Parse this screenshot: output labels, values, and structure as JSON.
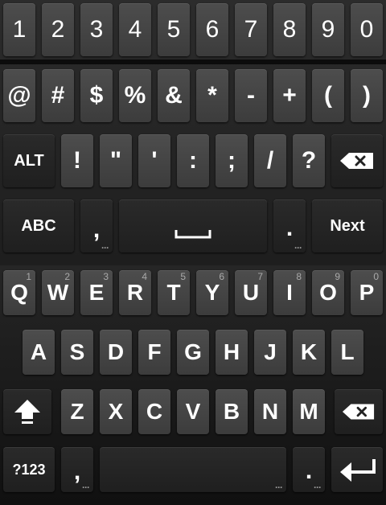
{
  "symbols_keyboard": {
    "row1": [
      "1",
      "2",
      "3",
      "4",
      "5",
      "6",
      "7",
      "8",
      "9",
      "0"
    ],
    "row2": [
      "@",
      "#",
      "$",
      "%",
      "&",
      "*",
      "-",
      "+",
      "(",
      ")"
    ],
    "row3": {
      "alt_label": "ALT",
      "keys": [
        "!",
        "\"",
        "'",
        ":",
        ";",
        "/",
        "?"
      ],
      "delete_icon": "backspace-icon"
    },
    "row4": {
      "abc_label": "ABC",
      "comma": ",",
      "space_icon": "space-bar-icon",
      "period": ".",
      "next_label": "Next"
    }
  },
  "qwerty_keyboard": {
    "row1": [
      {
        "label": "Q",
        "hint": "1"
      },
      {
        "label": "W",
        "hint": "2"
      },
      {
        "label": "E",
        "hint": "3"
      },
      {
        "label": "R",
        "hint": "4"
      },
      {
        "label": "T",
        "hint": "5"
      },
      {
        "label": "Y",
        "hint": "6"
      },
      {
        "label": "U",
        "hint": "7"
      },
      {
        "label": "I",
        "hint": "8"
      },
      {
        "label": "O",
        "hint": "9"
      },
      {
        "label": "P",
        "hint": "0"
      }
    ],
    "row2": [
      "A",
      "S",
      "D",
      "F",
      "G",
      "H",
      "J",
      "K",
      "L"
    ],
    "row3": {
      "shift_icon": "shift-arrow-icon",
      "keys": [
        "Z",
        "X",
        "C",
        "V",
        "B",
        "N",
        "M"
      ],
      "delete_icon": "backspace-icon"
    },
    "row4": {
      "symbols_label": "?123",
      "comma": ",",
      "space_icon": "space-bar-icon",
      "period": ".",
      "enter_icon": "enter-arrow-icon"
    }
  },
  "colors": {
    "key_light": "#474747",
    "key_dark": "#252525",
    "text": "#ffffff",
    "hint": "#aaaaaa"
  }
}
